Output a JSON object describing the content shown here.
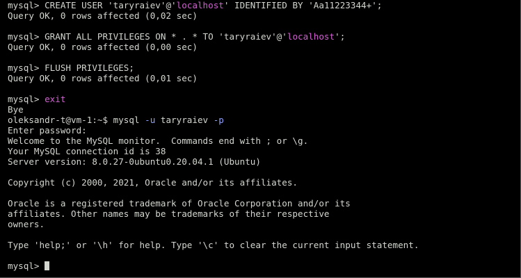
{
  "terminal": {
    "lines": [
      [
        {
          "t": "mysql> CREATE USER 'taryraiev'@'"
        },
        {
          "t": "localhost",
          "c": "magenta"
        },
        {
          "t": "' IDENTIFIED BY 'Aa11223344+';"
        }
      ],
      [
        {
          "t": "Query OK, 0 rows affected (0,02 sec)"
        }
      ],
      [],
      [
        {
          "t": "mysql> GRANT ALL PRIVILEGES ON * . * TO 'taryraiev'@'"
        },
        {
          "t": "localhost",
          "c": "magenta"
        },
        {
          "t": "';"
        }
      ],
      [
        {
          "t": "Query OK, 0 rows affected (0,00 sec)"
        }
      ],
      [],
      [
        {
          "t": "mysql> FLUSH PRIVILEGES;"
        }
      ],
      [
        {
          "t": "Query OK, 0 rows affected (0,01 sec)"
        }
      ],
      [],
      [
        {
          "t": "mysql> "
        },
        {
          "t": "exit",
          "c": "magenta"
        }
      ],
      [
        {
          "t": "Bye"
        }
      ],
      [
        {
          "t": "oleksandr-t@vm-1:~$ mysql "
        },
        {
          "t": "-u",
          "c": "blue"
        },
        {
          "t": " taryraiev "
        },
        {
          "t": "-p",
          "c": "blue"
        }
      ],
      [
        {
          "t": "Enter password:"
        }
      ],
      [
        {
          "t": "Welcome to the MySQL monitor.  Commands end with ; or \\g."
        }
      ],
      [
        {
          "t": "Your MySQL connection id is 38"
        }
      ],
      [
        {
          "t": "Server version: 8.0.27-0ubuntu0.20.04.1 (Ubuntu)"
        }
      ],
      [],
      [
        {
          "t": "Copyright (c) 2000, 2021, Oracle and/or its affiliates."
        }
      ],
      [],
      [
        {
          "t": "Oracle is a registered trademark of Oracle Corporation and/or its"
        }
      ],
      [
        {
          "t": "affiliates. Other names may be trademarks of their respective"
        }
      ],
      [
        {
          "t": "owners."
        }
      ],
      [],
      [
        {
          "t": "Type 'help;' or '\\h' for help. Type '\\c' to clear the current input statement."
        }
      ],
      [],
      [
        {
          "t": "mysql> "
        }
      ]
    ],
    "cursor_line": 25,
    "colors": {
      "background": "#000000",
      "foreground": "#d3d7cf",
      "magenta": "#d060d0",
      "blue": "#8fa0ff"
    }
  }
}
